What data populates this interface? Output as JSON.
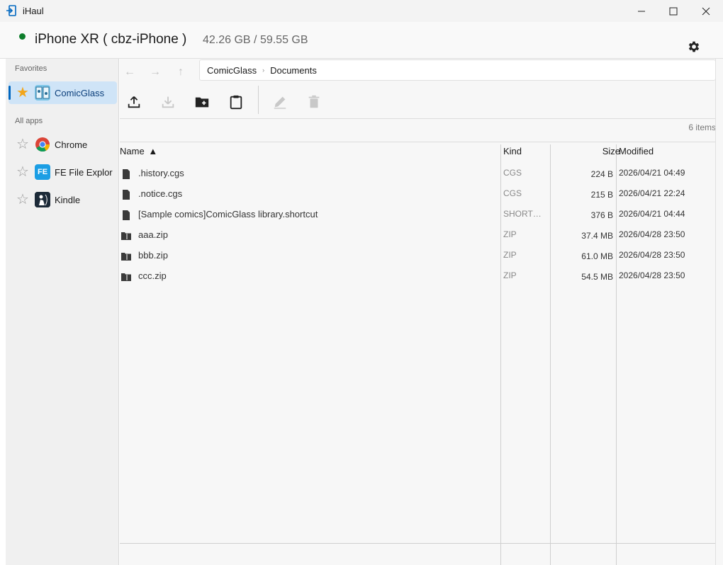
{
  "window": {
    "title": "iHaul"
  },
  "device": {
    "name": "iPhone XR ( cbz-iPhone )",
    "storage": "42.26 GB / 59.55 GB",
    "status_color": "#0d7d2b"
  },
  "sidebar": {
    "favorites_label": "Favorites",
    "all_apps_label": "All apps",
    "favorites": [
      {
        "label": "ComicGlass",
        "starred": true,
        "icon": "comicglass-icon"
      }
    ],
    "apps": [
      {
        "label": "Chrome",
        "starred": false,
        "icon": "chrome-icon"
      },
      {
        "label": "FE File Explorer",
        "starred": false,
        "icon": "fe-file-explorer-icon",
        "icon_text": "FE"
      },
      {
        "label": "Kindle",
        "starred": false,
        "icon": "kindle-icon"
      }
    ]
  },
  "breadcrumb": [
    "ComicGlass",
    "Documents"
  ],
  "item_count": "6 items",
  "table": {
    "headers": {
      "name": "Name",
      "kind": "Kind",
      "size": "Size",
      "modified": "Modified"
    },
    "sort_indicator": "▲",
    "rows": [
      {
        "name": ".history.cgs",
        "kind": "CGS",
        "size": "224 B",
        "modified": "2026/04/21 04:49",
        "icon": "file-icon"
      },
      {
        "name": ".notice.cgs",
        "kind": "CGS",
        "size": "215 B",
        "modified": "2026/04/21 22:24",
        "icon": "file-icon"
      },
      {
        "name": "[Sample comics]ComicGlass library.shortcut",
        "kind": "SHORTCUT",
        "size": "376 B",
        "modified": "2026/04/21 04:44",
        "icon": "file-icon"
      },
      {
        "name": "aaa.zip",
        "kind": "ZIP",
        "size": "37.4 MB",
        "modified": "2026/04/28 23:50",
        "icon": "zip-folder-icon"
      },
      {
        "name": "bbb.zip",
        "kind": "ZIP",
        "size": "61.0 MB",
        "modified": "2026/04/28 23:50",
        "icon": "zip-folder-icon"
      },
      {
        "name": "ccc.zip",
        "kind": "ZIP",
        "size": "54.5 MB",
        "modified": "2026/04/28 23:50",
        "icon": "zip-folder-icon"
      }
    ]
  },
  "colors": {
    "accent": "#0067c0",
    "star": "#f2a51a",
    "selected_bg": "#cfe4f7"
  }
}
